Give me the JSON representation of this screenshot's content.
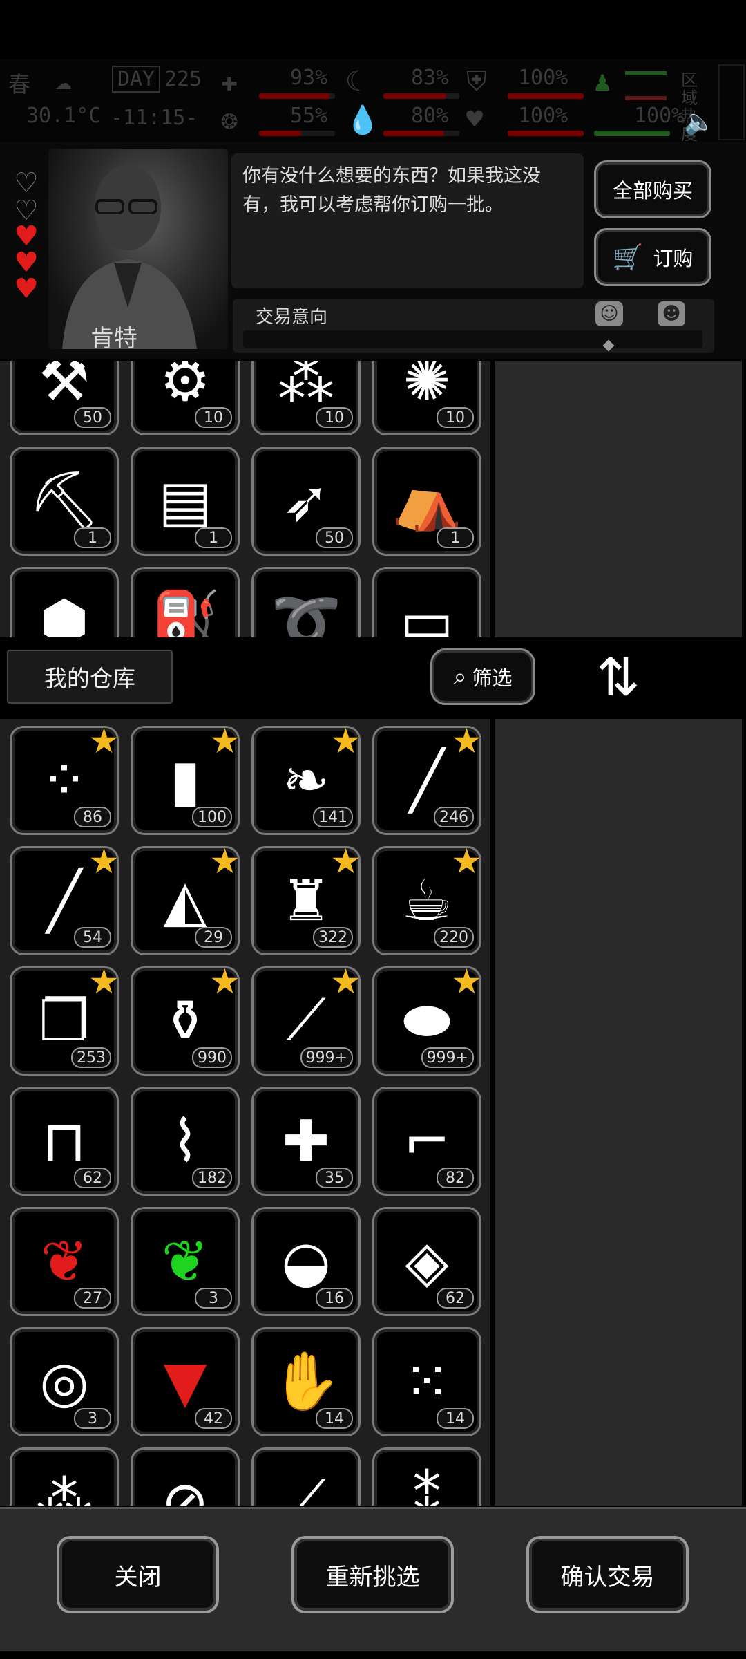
{
  "status": {
    "season": "春",
    "day_label": "DAY",
    "day": "225",
    "temperature": "30.1°C",
    "time": "-11:15-",
    "zone_label": "区域热度",
    "stats": [
      {
        "value": "93%",
        "fill": 0.93,
        "color": "#7a0000"
      },
      {
        "value": "83%",
        "fill": 0.83,
        "color": "#7a0000"
      },
      {
        "value": "100%",
        "fill": 1.0,
        "color": "#7a0000"
      },
      {
        "value": "55%",
        "fill": 0.55,
        "color": "#7a0000"
      },
      {
        "value": "80%",
        "fill": 0.8,
        "color": "#7a0000"
      },
      {
        "value": "100%",
        "fill": 1.0,
        "color": "#7a0000"
      },
      {
        "value": "100%",
        "fill": 1.0,
        "color": "#1f5a1f"
      }
    ]
  },
  "npc": {
    "name": "肯特",
    "dialog": "你有没什么想要的东西？如果我这没有，我可以考虑帮你订购一批。",
    "hearts": [
      "empty",
      "empty",
      "full",
      "full",
      "full"
    ]
  },
  "header_buttons": {
    "buy_all": "全部购买",
    "order": "订购"
  },
  "trade_intent": {
    "label": "交易意向"
  },
  "merchant_items": [
    {
      "icon": "saw-icon",
      "glyph": "⚒",
      "count": "50"
    },
    {
      "icon": "gears-icon",
      "glyph": "⚙",
      "count": "10"
    },
    {
      "icon": "debris-icon",
      "glyph": "⁂",
      "count": "10"
    },
    {
      "icon": "cotton-icon",
      "glyph": "✺",
      "count": "10"
    },
    {
      "icon": "axe-icon",
      "glyph": "⛏",
      "count": "1"
    },
    {
      "icon": "toolbox-icon",
      "glyph": "▤",
      "count": "1"
    },
    {
      "icon": "electric-arrow-icon",
      "glyph": "➶",
      "count": "50"
    },
    {
      "icon": "backpack-icon",
      "glyph": "⛺",
      "count": "1"
    },
    {
      "icon": "weight-icon",
      "glyph": "⬢",
      "count": ""
    },
    {
      "icon": "fuel-can-icon",
      "glyph": "⛽",
      "count": ""
    },
    {
      "icon": "rope-icon",
      "glyph": "➰",
      "count": ""
    },
    {
      "icon": "case-icon",
      "glyph": "▭",
      "count": ""
    }
  ],
  "warehouse": {
    "title": "我的仓库",
    "filter_label": "筛选"
  },
  "warehouse_items": [
    {
      "icon": "skewer-icon",
      "glyph": "⁘",
      "count": "86",
      "starred": true
    },
    {
      "icon": "water-bottle-icon",
      "glyph": "▮",
      "count": "100",
      "starred": true
    },
    {
      "icon": "bottle-pills-icon",
      "glyph": "❧",
      "count": "141",
      "starred": true
    },
    {
      "icon": "cigar-icon",
      "glyph": "╱",
      "count": "246",
      "starred": true
    },
    {
      "icon": "cigarette-icon",
      "glyph": "╱",
      "count": "54",
      "starred": true
    },
    {
      "icon": "cheese-icon",
      "glyph": "◭",
      "count": "29",
      "starred": true
    },
    {
      "icon": "liquor-bottle-icon",
      "glyph": "♜",
      "count": "322",
      "starred": true
    },
    {
      "icon": "coffee-cup-icon",
      "glyph": "☕",
      "count": "220",
      "starred": true
    },
    {
      "icon": "paper-roll-icon",
      "glyph": "❐",
      "count": "253",
      "starred": true
    },
    {
      "icon": "small-bottles-icon",
      "glyph": "⚱",
      "count": "990",
      "starred": true
    },
    {
      "icon": "glass-bottle-icon",
      "glyph": "⟋",
      "count": "999+",
      "starred": true
    },
    {
      "icon": "potato-icon",
      "glyph": "⬬",
      "count": "999+",
      "starred": true
    },
    {
      "icon": "towel-icon",
      "glyph": "⊓",
      "count": "62",
      "starred": false
    },
    {
      "icon": "bandage-icon",
      "glyph": "⌇",
      "count": "182",
      "starred": false
    },
    {
      "icon": "syringe-icon",
      "glyph": "✚",
      "count": "35",
      "starred": false
    },
    {
      "icon": "flare-gun-icon",
      "glyph": "⌐",
      "count": "82",
      "starred": false
    },
    {
      "icon": "red-herb-icon",
      "glyph": "❦",
      "count": "27",
      "starred": false,
      "tint": "#e21b1b"
    },
    {
      "icon": "green-herb-icon",
      "glyph": "❦",
      "count": "3",
      "starred": false,
      "tint": "#1fd41f"
    },
    {
      "icon": "soup-bowl-icon",
      "glyph": "◒",
      "count": "16",
      "starred": false
    },
    {
      "icon": "rations-icon",
      "glyph": "◈",
      "count": "62",
      "starred": false
    },
    {
      "icon": "gas-mask-icon",
      "glyph": "◎",
      "count": "3",
      "starred": false
    },
    {
      "icon": "blood-cup-icon",
      "glyph": "▼",
      "count": "42",
      "starred": false,
      "tint": "#e21b1b"
    },
    {
      "icon": "ginger-icon",
      "glyph": "✋",
      "count": "14",
      "starred": false
    },
    {
      "icon": "beans-icon",
      "glyph": "⁙",
      "count": "14",
      "starred": false
    },
    {
      "icon": "nuts-icon",
      "glyph": "⁂",
      "count": "",
      "starred": false
    },
    {
      "icon": "pills-icon",
      "glyph": "⊘",
      "count": "",
      "starred": false
    },
    {
      "icon": "tube-icon",
      "glyph": "⟋",
      "count": "",
      "starred": false
    },
    {
      "icon": "capsules-icon",
      "glyph": "⁑",
      "count": "",
      "starred": false
    }
  ],
  "footer": {
    "close": "关闭",
    "reselect": "重新挑选",
    "confirm": "确认交易"
  }
}
